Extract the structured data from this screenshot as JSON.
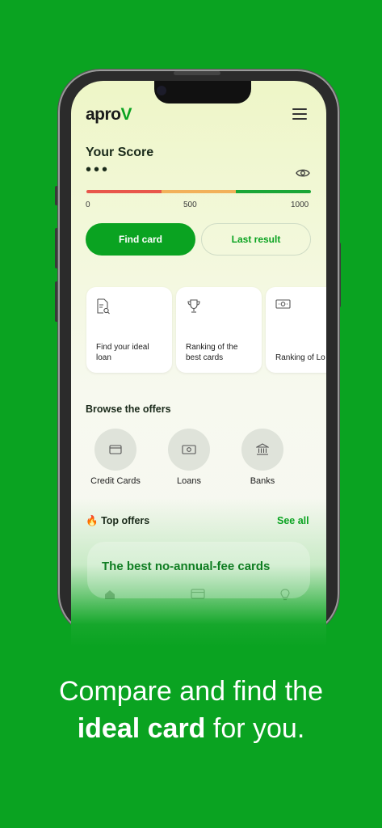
{
  "app": {
    "logo_main": "apro",
    "logo_accent": "V"
  },
  "score": {
    "title": "Your Score",
    "masked_value": "•••",
    "scale_min": "0",
    "scale_mid": "500",
    "scale_max": "1000",
    "bar_colors": [
      "#e8574b",
      "#f2b15a",
      "#1aa637"
    ]
  },
  "actions": {
    "find_card": "Find card",
    "last_result": "Last result"
  },
  "quick_cards": [
    {
      "label": "Find your ideal\nloan",
      "icon": "document-search-icon"
    },
    {
      "label": "Ranking of the\nbest cards",
      "icon": "trophy-icon"
    },
    {
      "label": "Ranking of Lo",
      "icon": "money-icon"
    }
  ],
  "browse": {
    "title": "Browse the offers",
    "categories": [
      {
        "label": "Credit Cards",
        "icon": "credit-card-icon"
      },
      {
        "label": "Loans",
        "icon": "money-icon"
      },
      {
        "label": "Banks",
        "icon": "bank-icon"
      }
    ]
  },
  "offers": {
    "title": "Top offers",
    "emoji": "🔥",
    "see_all": "See all",
    "first_offer": "The best no-annual-fee cards"
  },
  "caption": {
    "line1": "Compare and find the",
    "bold": "ideal card",
    "rest": " for you."
  },
  "colors": {
    "brand": "#0aa321"
  }
}
